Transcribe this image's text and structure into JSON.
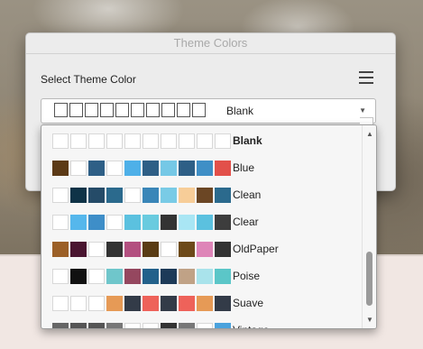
{
  "dialog": {
    "title": "Theme Colors",
    "select_label": "Select Theme Color",
    "menu_icon": "hamburger-menu-icon",
    "combo": {
      "value": "Blank",
      "arrow_icon": "chevron-down-icon",
      "swatch_count": 10
    }
  },
  "dropdown": {
    "scroll_up_icon": "scroll-up-arrow-icon",
    "scroll_down_icon": "scroll-down-arrow-icon",
    "scroll_position": 0.85,
    "selected": "Blank",
    "themes": [
      {
        "name": "Blank",
        "colors": [
          "#ffffff",
          "#ffffff",
          "#ffffff",
          "#ffffff",
          "#ffffff",
          "#ffffff",
          "#ffffff",
          "#ffffff",
          "#ffffff",
          "#ffffff"
        ]
      },
      {
        "name": "Blue",
        "colors": [
          "#5c3a16",
          "#ffffff",
          "#2e5f86",
          "#ffffff",
          "#4eb0e8",
          "#2e5f86",
          "#75c8e6",
          "#2e5f86",
          "#3f8fc6",
          "#e2504a"
        ]
      },
      {
        "name": "Clean",
        "colors": [
          "#ffffff",
          "#0f3347",
          "#254b68",
          "#2b6a8d",
          "#ffffff",
          "#3a86b8",
          "#79cbe6",
          "#f7cd98",
          "#6b4624",
          "#2b6a8d"
        ]
      },
      {
        "name": "Clear",
        "colors": [
          "#ffffff",
          "#55b7ec",
          "#3e8ec8",
          "#ffffff",
          "#5bc1df",
          "#69cbdf",
          "#333333",
          "#a9e6f4",
          "#5bc1df",
          "#3d3d3d"
        ]
      },
      {
        "name": "OldPaper",
        "colors": [
          "#9c6027",
          "#4a1530",
          "#ffffff",
          "#333333",
          "#b35080",
          "#5a3c14",
          "#ffffff",
          "#6d4a1a",
          "#de85b8",
          "#333333"
        ]
      },
      {
        "name": "Poise",
        "colors": [
          "#ffffff",
          "#111111",
          "#ffffff",
          "#6fc6cb",
          "#95475f",
          "#23618b",
          "#1d3a58",
          "#c0a286",
          "#a9e3eb",
          "#5bc6c8"
        ]
      },
      {
        "name": "Suave",
        "colors": [
          "#ffffff",
          "#ffffff",
          "#ffffff",
          "#e69a56",
          "#333b48",
          "#ee625a",
          "#333b48",
          "#ee625a",
          "#e69a56",
          "#333b48"
        ]
      },
      {
        "name": "Vintage",
        "colors": [
          "#666666",
          "#555555",
          "#555555",
          "#777777",
          "#ffffff",
          "#ffffff",
          "#333333",
          "#777777",
          "#ffffff",
          "#4aa2dd"
        ]
      }
    ]
  }
}
